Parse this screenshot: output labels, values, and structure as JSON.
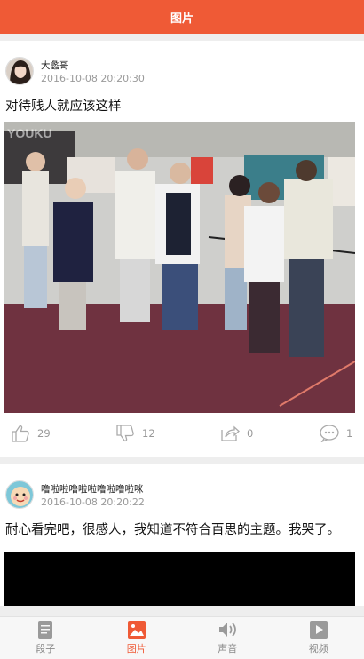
{
  "header": {
    "title": "图片"
  },
  "posts": [
    {
      "username": "大蠡哥",
      "time": "2016-10-08 20:20:30",
      "text": "对待贱人就应该这样",
      "media_watermark": "YOUKU",
      "likes": "29",
      "dislikes": "12",
      "shares": "0",
      "comments": "1"
    },
    {
      "username": "噜啦啦噜啦啦噜啦噜啦咪",
      "time": "2016-10-08 20:20:22",
      "text": "耐心看完吧，很感人，我知道不符合百思的主题。我哭了。"
    }
  ],
  "tabs": [
    {
      "label": "段子",
      "icon": "document-icon"
    },
    {
      "label": "图片",
      "icon": "image-icon",
      "active": true
    },
    {
      "label": "声音",
      "icon": "speaker-icon"
    },
    {
      "label": "视频",
      "icon": "video-icon"
    }
  ],
  "colors": {
    "accent": "#ef5a36",
    "muted": "#999999"
  }
}
